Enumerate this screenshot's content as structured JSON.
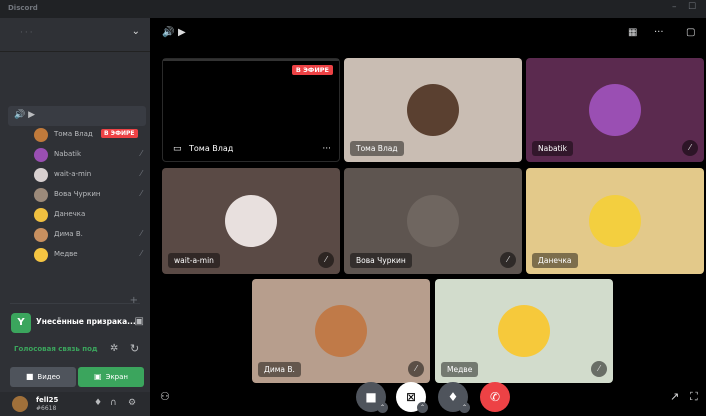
{
  "titlebar": {
    "app_name": "Discord",
    "minimize": "–",
    "maximize": "☐"
  },
  "server": {
    "chevron": "⌄"
  },
  "voice_channel": {
    "icons": "🔊 ▶"
  },
  "members": [
    {
      "name": "Тома Влад",
      "live": "В ЭФИРЕ",
      "color": "#c07a3b"
    },
    {
      "name": "Nabatik",
      "color": "#9a4fb3"
    },
    {
      "name": "wait-a-min",
      "color": "#d8d0d0"
    },
    {
      "name": "Вова Чуркин",
      "color": "#9c8a7a"
    },
    {
      "name": "Данечка",
      "color": "#f0c040"
    },
    {
      "name": "Дима В.",
      "color": "#c89060"
    },
    {
      "name": "Медве",
      "color": "#f5c542"
    }
  ],
  "activity": {
    "icon_letter": "Y",
    "text": "Унесённые призрака..."
  },
  "voice_status": {
    "text": "Голосовая связь под"
  },
  "buttons": {
    "video": "Видео",
    "screen": "Экран"
  },
  "user": {
    "name": "fell25",
    "tag": "#6618"
  },
  "stream": {
    "live": "В ЭФИРЕ",
    "name": "Тома Влад",
    "more": "···"
  },
  "tiles": [
    {
      "name": "Тома Влад",
      "bg": "#c9bdb3",
      "avatar": "#5a4030"
    },
    {
      "name": "Nabatik",
      "bg": "#5b2a4f",
      "avatar": "#9a4fb3"
    },
    {
      "name": "wait-a-min",
      "bg": "#5a4a45",
      "avatar": "#e8e0de"
    },
    {
      "name": "Вова Чуркин",
      "bg": "#5e5550",
      "avatar": "#6f6660"
    },
    {
      "name": "Данечка",
      "bg": "#e3c98a",
      "avatar": "#f3cf3f"
    },
    {
      "name": "Дима В.",
      "bg": "#b79e8d",
      "avatar": "#c07a48"
    },
    {
      "name": "Медве",
      "bg": "#d2dccc",
      "avatar": "#f6c93b"
    }
  ],
  "colors": {
    "accent_green": "#3ba55d",
    "live_red": "#ed4245"
  }
}
